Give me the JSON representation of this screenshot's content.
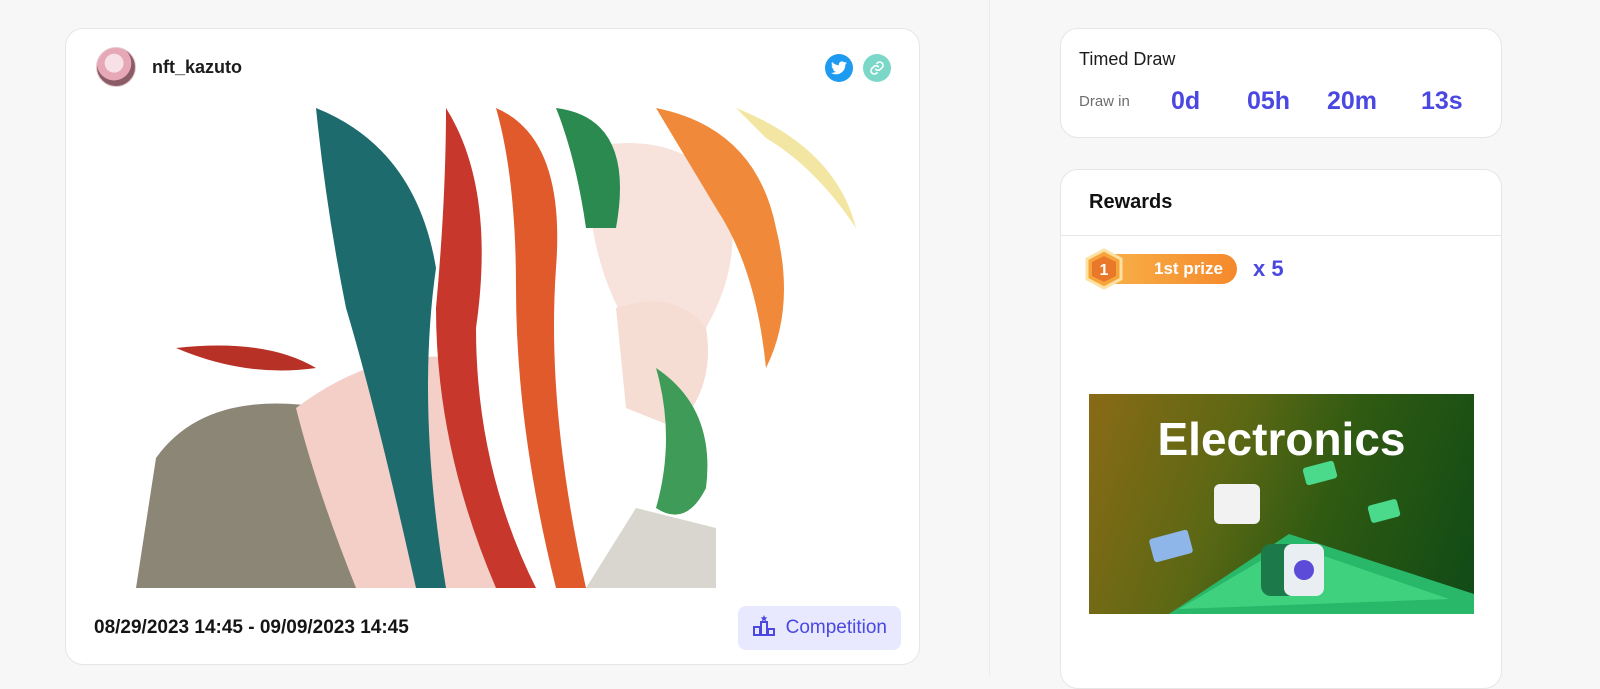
{
  "post": {
    "author": "nft_kazuto",
    "date_range": "08/29/2023 14:45 - 09/09/2023 14:45",
    "tag_label": "Competition"
  },
  "timed_draw": {
    "title": "Timed Draw",
    "label": "Draw in",
    "days": "0d",
    "hours": "05h",
    "minutes": "20m",
    "seconds": "13s"
  },
  "rewards": {
    "title": "Rewards",
    "prize_rank": "1",
    "prize_label": "1st prize",
    "prize_count": "x 5",
    "banner_text": "Electronics"
  },
  "colors": {
    "accent": "#4a48e0",
    "twitter": "#1d9bf0",
    "link_icon": "#7bd8c9",
    "prize_orange": "#f5892c"
  },
  "icons": [
    "twitter-icon",
    "link-icon",
    "podium-icon",
    "medal-icon"
  ]
}
